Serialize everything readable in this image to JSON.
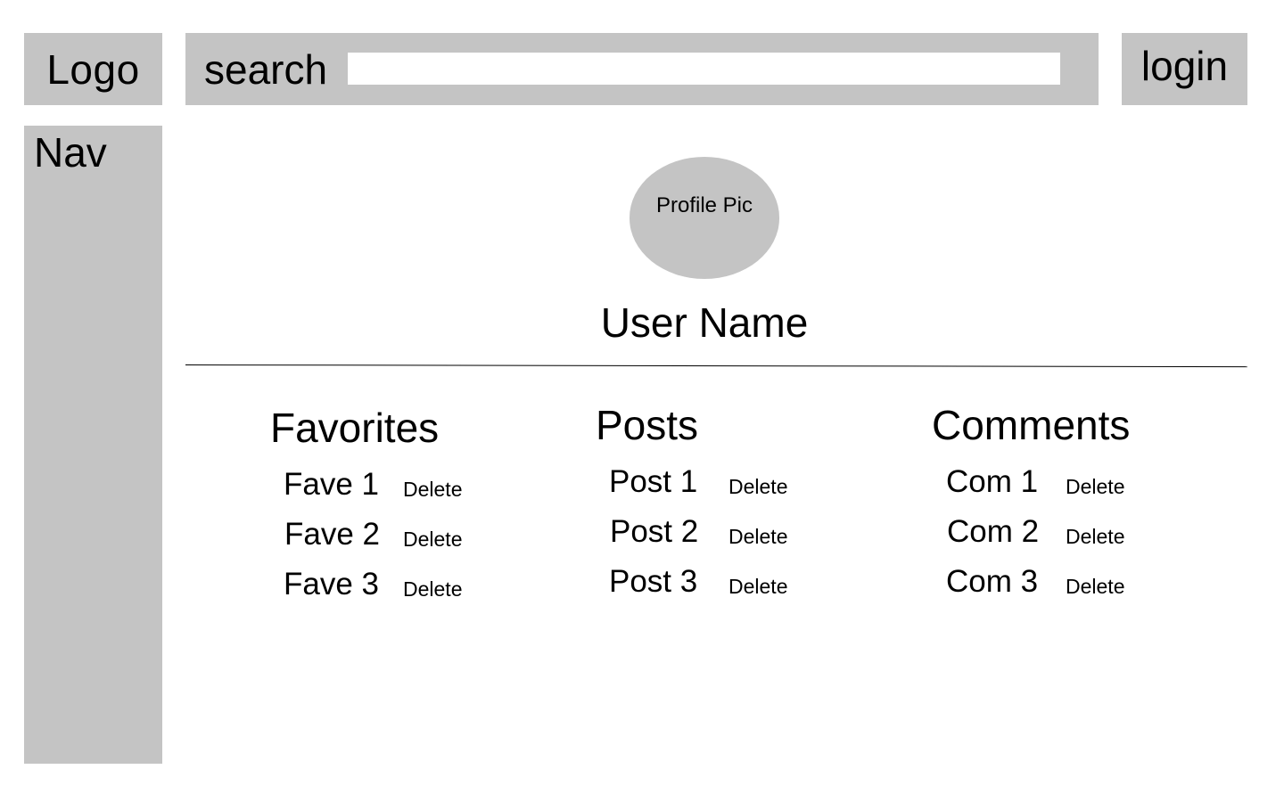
{
  "header": {
    "logo_label": "Logo",
    "search_label": "search",
    "search_value": "",
    "login_label": "login"
  },
  "nav": {
    "title": "Nav"
  },
  "profile": {
    "pic_label": "Profile Pic",
    "user_name": "User Name"
  },
  "favorites": {
    "title": "Favorites",
    "items": [
      {
        "label": "Fave 1",
        "action": "Delete"
      },
      {
        "label": "Fave 2",
        "action": "Delete"
      },
      {
        "label": "Fave 3",
        "action": "Delete"
      }
    ]
  },
  "posts": {
    "title": "Posts",
    "items": [
      {
        "label": "Post 1",
        "action": "Delete"
      },
      {
        "label": "Post 2",
        "action": "Delete"
      },
      {
        "label": "Post 3",
        "action": "Delete"
      }
    ]
  },
  "comments": {
    "title": "Comments",
    "items": [
      {
        "label": "Com 1",
        "action": "Delete"
      },
      {
        "label": "Com 2",
        "action": "Delete"
      },
      {
        "label": "Com 3",
        "action": "Delete"
      }
    ]
  },
  "colors": {
    "box_fill": "#c4c4c4",
    "background": "#ffffff",
    "text": "#000000"
  }
}
